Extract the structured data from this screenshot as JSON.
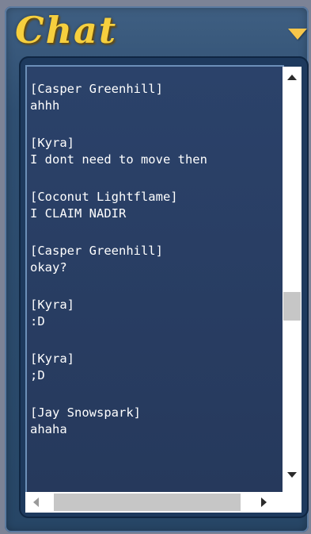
{
  "window": {
    "title": "Chat",
    "title_color": "#f6cf3e",
    "collapse_icon": "triangle-down-icon"
  },
  "chat": {
    "messages": [
      {
        "sender": "[Casper Greenhill]",
        "text": "ahhh"
      },
      {
        "sender": "[Kyra]",
        "text": "I dont need to move then"
      },
      {
        "sender": "[Coconut Lightflame]",
        "text": "I CLAIM NADIR"
      },
      {
        "sender": "[Casper Greenhill]",
        "text": "okay?"
      },
      {
        "sender": "[Kyra]",
        "text": ":D"
      },
      {
        "sender": "[Kyra]",
        "text": ";D"
      },
      {
        "sender": "[Jay Snowspark]",
        "text": "ahaha"
      }
    ]
  },
  "scrollbars": {
    "up_icon": "arrow-up-icon",
    "down_icon": "arrow-down-icon",
    "left_icon": "arrow-left-icon",
    "right_icon": "arrow-right-icon"
  },
  "colors": {
    "panel": "#2f4f72",
    "chat_background": "#26395c",
    "text": "#ffffff"
  }
}
